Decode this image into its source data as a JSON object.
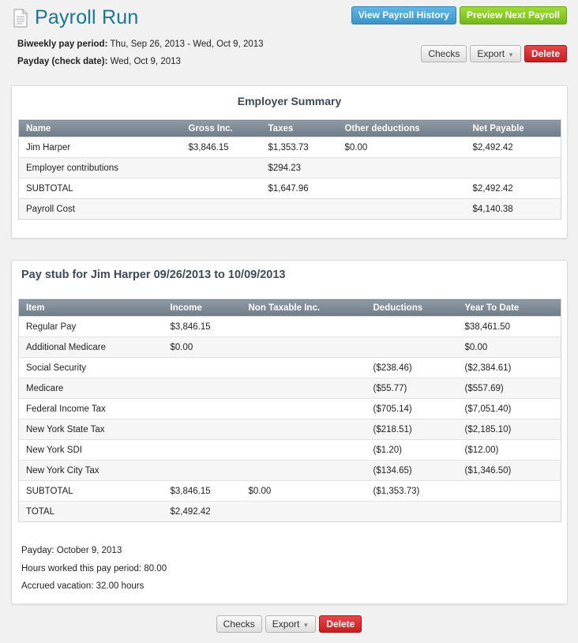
{
  "page": {
    "title": "Payroll Run"
  },
  "period": {
    "period_label": "Biweekly pay period:",
    "period_value": "Thu, Sep 26, 2013 - Wed, Oct 9, 2013",
    "payday_label": "Payday (check date):",
    "payday_value": "Wed, Oct 9, 2013"
  },
  "actions": {
    "view_history": "View Payroll History",
    "preview_next": "Preview Next Payroll",
    "checks": "Checks",
    "export": "Export",
    "delete": "Delete"
  },
  "employer_summary": {
    "title": "Employer Summary",
    "columns": [
      "Name",
      "Gross Inc.",
      "Taxes",
      "Other deductions",
      "Net Payable"
    ],
    "rows": [
      [
        "Jim Harper",
        "$3,846.15",
        "$1,353.73",
        "$0.00",
        "$2,492.42"
      ],
      [
        "Employer contributions",
        "",
        "$294.23",
        "",
        ""
      ],
      [
        "SUBTOTAL",
        "",
        "$1,647.96",
        "",
        "$2,492.42"
      ],
      [
        "Payroll Cost",
        "",
        "",
        "",
        "$4,140.38"
      ]
    ]
  },
  "pay_stub": {
    "title": "Pay stub for Jim Harper 09/26/2013 to 10/09/2013",
    "columns": [
      "Item",
      "Income",
      "Non Taxable Inc.",
      "Deductions",
      "Year To Date"
    ],
    "rows": [
      [
        "Regular Pay",
        "$3,846.15",
        "",
        "",
        "$38,461.50"
      ],
      [
        "Additional Medicare",
        "$0.00",
        "",
        "",
        "$0.00"
      ],
      [
        "Social Security",
        "",
        "",
        "($238.46)",
        "($2,384.61)"
      ],
      [
        "Medicare",
        "",
        "",
        "($55.77)",
        "($557.69)"
      ],
      [
        "Federal Income Tax",
        "",
        "",
        "($705.14)",
        "($7,051.40)"
      ],
      [
        "New York State Tax",
        "",
        "",
        "($218.51)",
        "($2,185.10)"
      ],
      [
        "New York SDI",
        "",
        "",
        "($1.20)",
        "($12.00)"
      ],
      [
        "New York City Tax",
        "",
        "",
        "($134.65)",
        "($1,346.50)"
      ],
      [
        "SUBTOTAL",
        "$3,846.15",
        "$0.00",
        "($1,353.73)",
        ""
      ],
      [
        "TOTAL",
        "$2,492.42",
        "",
        "",
        ""
      ]
    ],
    "notes": [
      "Payday: October 9, 2013",
      "Hours worked this pay period: 80.00",
      "Accrued vacation: 32.00 hours"
    ]
  }
}
